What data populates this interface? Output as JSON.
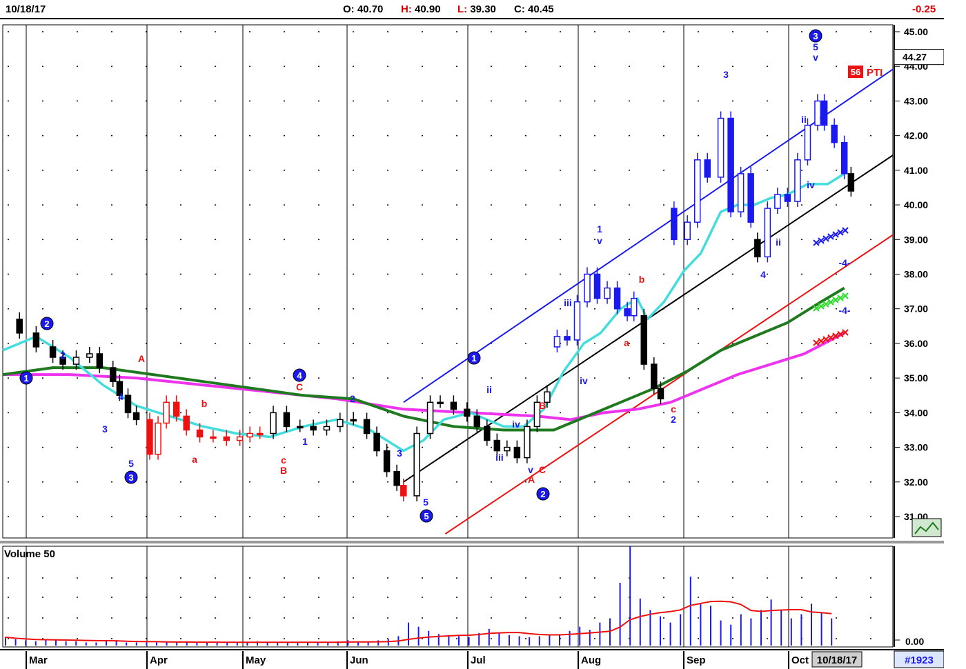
{
  "header": {
    "date": "10/18/17",
    "open_label": "O:",
    "open": "40.70",
    "high_label": "H:",
    "high": "40.90",
    "low_label": "L:",
    "low": "39.30",
    "close_label": "C:",
    "close": "40.45",
    "change": "-0.25"
  },
  "price_tag": "44.27",
  "volume_panel": {
    "title": "Volume 50",
    "axis_label": "0.00"
  },
  "footer": {
    "date_box": "10/18/17",
    "chart_id": "#1923"
  },
  "months": [
    "Mar",
    "Apr",
    "May",
    "Jun",
    "Jul",
    "Aug",
    "Sep",
    "Oct"
  ],
  "pti_badge": {
    "number": "56",
    "text": "PTI"
  },
  "colors": {
    "up_down_red": "#ee1111",
    "candle_blue": "#1a1aee",
    "candle_black": "#000000",
    "ma_cyan": "#44dddd",
    "ma_green": "#1f7a1f",
    "ma_magenta": "#ee33ee",
    "channel_blue": "#1a1aee",
    "channel_black": "#000000",
    "channel_red": "#ee1111"
  },
  "chart_data": {
    "type": "candlestick",
    "ylim": [
      31,
      45
    ],
    "yticks": [
      "31.00",
      "32.00",
      "33.00",
      "34.00",
      "35.00",
      "36.00",
      "37.00",
      "38.00",
      "39.00",
      "40.00",
      "41.00",
      "42.00",
      "43.00",
      "44.00",
      "45.00"
    ],
    "price_segments": [
      {
        "color": "black",
        "points": [
          [
            0,
            36.7
          ],
          [
            10,
            36.3
          ],
          [
            20,
            35.9
          ],
          [
            30,
            35.6
          ],
          [
            36,
            35.4
          ],
          [
            44,
            35.6
          ],
          [
            52,
            35.7
          ],
          [
            58,
            35.3
          ],
          [
            66,
            34.9
          ],
          [
            70,
            34.5
          ],
          [
            75,
            34.0
          ],
          [
            80,
            33.8
          ]
        ]
      },
      {
        "color": "red",
        "points": [
          [
            80,
            33.8
          ],
          [
            88,
            32.8
          ],
          [
            93,
            33.7
          ],
          [
            98,
            34.3
          ],
          [
            104,
            33.9
          ],
          [
            110,
            33.5
          ],
          [
            118,
            33.3
          ],
          [
            126,
            33.3
          ],
          [
            134,
            33.2
          ],
          [
            142,
            33.3
          ],
          [
            148,
            33.4
          ],
          [
            154,
            33.4
          ]
        ]
      },
      {
        "color": "black",
        "points": [
          [
            154,
            33.4
          ],
          [
            162,
            34.0
          ],
          [
            170,
            33.6
          ],
          [
            178,
            33.6
          ],
          [
            186,
            33.5
          ],
          [
            194,
            33.6
          ],
          [
            202,
            33.8
          ],
          [
            210,
            33.8
          ],
          [
            218,
            33.4
          ],
          [
            224,
            32.9
          ],
          [
            230,
            32.3
          ],
          [
            236,
            31.9
          ]
        ]
      },
      {
        "color": "red",
        "points": [
          [
            236,
            31.9
          ],
          [
            240,
            31.6
          ]
        ]
      },
      {
        "color": "black",
        "points": [
          [
            240,
            31.6
          ],
          [
            248,
            33.4
          ],
          [
            256,
            34.3
          ],
          [
            262,
            34.3
          ],
          [
            270,
            34.1
          ],
          [
            278,
            33.9
          ],
          [
            284,
            33.6
          ],
          [
            290,
            33.2
          ],
          [
            296,
            32.9
          ],
          [
            302,
            33.0
          ],
          [
            308,
            32.7
          ],
          [
            314,
            33.6
          ],
          [
            320,
            34.3
          ],
          [
            326,
            34.6
          ]
        ]
      },
      {
        "color": "blue",
        "points": [
          [
            326,
            35.9
          ],
          [
            332,
            36.2
          ],
          [
            338,
            36.1
          ],
          [
            344,
            37.2
          ],
          [
            350,
            38.0
          ],
          [
            356,
            37.3
          ],
          [
            362,
            37.6
          ],
          [
            368,
            37.0
          ],
          [
            374,
            36.8
          ],
          [
            378,
            37.3
          ]
        ]
      },
      {
        "color": "black",
        "points": [
          [
            378,
            36.8
          ],
          [
            384,
            35.4
          ],
          [
            390,
            34.7
          ],
          [
            394,
            34.4
          ]
        ]
      },
      {
        "color": "blue",
        "points": [
          [
            394,
            39.9
          ],
          [
            402,
            39.0
          ],
          [
            410,
            39.5
          ],
          [
            416,
            41.3
          ],
          [
            422,
            40.8
          ],
          [
            430,
            42.5
          ],
          [
            436,
            39.8
          ],
          [
            442,
            40.9
          ],
          [
            448,
            39.5
          ]
        ]
      },
      {
        "color": "black",
        "points": [
          [
            448,
            39.0
          ],
          [
            452,
            38.5
          ]
        ]
      },
      {
        "color": "blue",
        "points": [
          [
            452,
            38.5
          ],
          [
            458,
            39.9
          ],
          [
            464,
            40.3
          ],
          [
            470,
            40.1
          ],
          [
            476,
            41.3
          ],
          [
            482,
            42.3
          ],
          [
            488,
            43.0
          ],
          [
            492,
            42.3
          ],
          [
            498,
            41.8
          ],
          [
            504,
            40.9
          ]
        ]
      },
      {
        "color": "black",
        "points": [
          [
            504,
            40.9
          ],
          [
            508,
            40.4
          ]
        ]
      }
    ],
    "ma_cyan": [
      [
        0,
        35.8
      ],
      [
        20,
        36.2
      ],
      [
        40,
        35.6
      ],
      [
        60,
        34.8
      ],
      [
        80,
        34.2
      ],
      [
        100,
        33.9
      ],
      [
        120,
        33.6
      ],
      [
        140,
        33.4
      ],
      [
        160,
        33.3
      ],
      [
        180,
        33.6
      ],
      [
        200,
        33.8
      ],
      [
        220,
        33.5
      ],
      [
        240,
        32.9
      ],
      [
        252,
        33.2
      ],
      [
        264,
        33.8
      ],
      [
        280,
        34.0
      ],
      [
        300,
        33.6
      ],
      [
        312,
        33.6
      ],
      [
        324,
        34.1
      ],
      [
        336,
        35.2
      ],
      [
        348,
        36.0
      ],
      [
        358,
        36.3
      ],
      [
        370,
        37.0
      ],
      [
        380,
        37.3
      ],
      [
        386,
        36.7
      ],
      [
        396,
        37.2
      ],
      [
        408,
        38.1
      ],
      [
        418,
        38.6
      ],
      [
        430,
        39.8
      ],
      [
        440,
        40.0
      ],
      [
        450,
        40.0
      ],
      [
        460,
        40.2
      ],
      [
        470,
        40.3
      ],
      [
        482,
        40.6
      ],
      [
        494,
        40.6
      ],
      [
        504,
        40.9
      ]
    ],
    "ma_green": [
      [
        0,
        35.1
      ],
      [
        30,
        35.3
      ],
      [
        60,
        35.3
      ],
      [
        90,
        35.1
      ],
      [
        120,
        34.9
      ],
      [
        150,
        34.7
      ],
      [
        180,
        34.5
      ],
      [
        210,
        34.4
      ],
      [
        240,
        33.9
      ],
      [
        270,
        33.6
      ],
      [
        300,
        33.5
      ],
      [
        330,
        33.5
      ],
      [
        350,
        33.9
      ],
      [
        370,
        34.3
      ],
      [
        390,
        34.7
      ],
      [
        410,
        35.2
      ],
      [
        430,
        35.8
      ],
      [
        450,
        36.2
      ],
      [
        470,
        36.6
      ],
      [
        490,
        37.2
      ],
      [
        504,
        37.6
      ]
    ],
    "ma_magenta": [
      [
        0,
        35.1
      ],
      [
        40,
        35.1
      ],
      [
        80,
        35.0
      ],
      [
        120,
        34.8
      ],
      [
        160,
        34.6
      ],
      [
        200,
        34.4
      ],
      [
        240,
        34.1
      ],
      [
        280,
        34.0
      ],
      [
        320,
        33.9
      ],
      [
        340,
        33.8
      ],
      [
        360,
        34.0
      ],
      [
        380,
        34.1
      ],
      [
        400,
        34.3
      ],
      [
        420,
        34.7
      ],
      [
        440,
        35.1
      ],
      [
        460,
        35.4
      ],
      [
        480,
        35.7
      ],
      [
        504,
        36.3
      ]
    ],
    "channels": [
      {
        "color": "blue",
        "from": [
          240,
          34.3
        ],
        "to": [
          560,
          44.8
        ]
      },
      {
        "color": "black",
        "from": [
          240,
          32.0
        ],
        "to": [
          560,
          42.3
        ]
      },
      {
        "color": "red",
        "from": [
          265,
          30.5
        ],
        "to": [
          560,
          40.0
        ]
      }
    ],
    "volume": [
      8,
      6,
      5,
      4,
      5,
      5,
      4,
      4,
      3,
      3,
      4,
      4,
      3,
      3,
      3,
      3,
      3,
      3,
      4,
      3,
      3,
      3,
      3,
      3,
      3,
      4,
      3,
      3,
      3,
      3,
      3,
      3,
      3,
      4,
      5,
      4,
      4,
      5,
      6,
      9,
      22,
      18,
      14,
      11,
      9,
      9,
      8,
      12,
      16,
      12,
      10,
      9,
      8,
      9,
      10,
      11,
      14,
      18,
      15,
      22,
      26,
      60,
      95,
      45,
      34,
      28,
      22,
      30,
      66,
      40,
      38,
      24,
      20,
      30,
      26,
      34,
      44,
      34,
      26,
      30,
      40,
      32,
      26
    ]
  },
  "annotations": [
    {
      "t": "1",
      "x": 38,
      "y": 548,
      "c": "blue",
      "circle": true
    },
    {
      "t": "2",
      "x": 68,
      "y": 469,
      "c": "blue",
      "circle": true
    },
    {
      "t": "2",
      "x": 91,
      "y": 520,
      "c": "blue"
    },
    {
      "t": "3",
      "x": 152,
      "y": 627,
      "c": "blue"
    },
    {
      "t": "4",
      "x": 175,
      "y": 580,
      "c": "blue"
    },
    {
      "t": "5",
      "x": 190,
      "y": 677,
      "c": "blue"
    },
    {
      "t": "3",
      "x": 190,
      "y": 692,
      "c": "blue",
      "circle": true
    },
    {
      "t": "A",
      "x": 205,
      "y": 525,
      "c": "red"
    },
    {
      "t": "b",
      "x": 296,
      "y": 590,
      "c": "red"
    },
    {
      "t": "a",
      "x": 282,
      "y": 671,
      "c": "red"
    },
    {
      "t": "C",
      "x": 434,
      "y": 566,
      "c": "red"
    },
    {
      "t": "4",
      "x": 434,
      "y": 544,
      "c": "blue",
      "circle": true
    },
    {
      "t": "c",
      "x": 411,
      "y": 672,
      "c": "red"
    },
    {
      "t": "B",
      "x": 411,
      "y": 687,
      "c": "red"
    },
    {
      "t": "1",
      "x": 442,
      "y": 645,
      "c": "blue"
    },
    {
      "t": "2",
      "x": 511,
      "y": 583,
      "c": "blue"
    },
    {
      "t": "3",
      "x": 579,
      "y": 662,
      "c": "blue"
    },
    {
      "t": "5",
      "x": 617,
      "y": 733,
      "c": "blue"
    },
    {
      "t": "5",
      "x": 618,
      "y": 748,
      "c": "blue",
      "circle": true
    },
    {
      "t": "1",
      "x": 687,
      "y": 519,
      "c": "blue",
      "circle": true
    },
    {
      "t": "ii",
      "x": 709,
      "y": 570,
      "c": "blue"
    },
    {
      "t": "iv",
      "x": 748,
      "y": 620,
      "c": "blue"
    },
    {
      "t": "iii",
      "x": 724,
      "y": 668,
      "c": "blue"
    },
    {
      "t": "v",
      "x": 769,
      "y": 686,
      "c": "blue"
    },
    {
      "t": "A",
      "x": 770,
      "y": 700,
      "c": "red"
    },
    {
      "t": "C",
      "x": 786,
      "y": 686,
      "c": "red"
    },
    {
      "t": "B",
      "x": 786,
      "y": 593,
      "c": "red"
    },
    {
      "t": "2",
      "x": 787,
      "y": 716,
      "c": "blue",
      "circle": true
    },
    {
      "t": "iii",
      "x": 823,
      "y": 444,
      "c": "blue"
    },
    {
      "t": "iv",
      "x": 846,
      "y": 557,
      "c": "blue"
    },
    {
      "t": "1",
      "x": 869,
      "y": 337,
      "c": "blue"
    },
    {
      "t": "v",
      "x": 869,
      "y": 354,
      "c": "blue"
    },
    {
      "t": "b",
      "x": 930,
      "y": 410,
      "c": "red"
    },
    {
      "t": "a",
      "x": 908,
      "y": 502,
      "c": "red"
    },
    {
      "t": "c",
      "x": 976,
      "y": 598,
      "c": "red"
    },
    {
      "t": "2",
      "x": 976,
      "y": 613,
      "c": "blue"
    },
    {
      "t": "3",
      "x": 1052,
      "y": 113,
      "c": "blue"
    },
    {
      "t": "ii",
      "x": 1128,
      "y": 356,
      "c": "blue"
    },
    {
      "t": "4",
      "x": 1106,
      "y": 403,
      "c": "blue"
    },
    {
      "t": "ii",
      "x": 1165,
      "y": 178,
      "c": "blue"
    },
    {
      "t": "iv",
      "x": 1175,
      "y": 273,
      "c": "blue"
    },
    {
      "t": "3",
      "x": 1182,
      "y": 52,
      "c": "blue",
      "circle": true
    },
    {
      "t": "5",
      "x": 1182,
      "y": 73,
      "c": "blue"
    },
    {
      "t": "v",
      "x": 1182,
      "y": 88,
      "c": "blue"
    },
    {
      "t": "-4-",
      "x": 1224,
      "y": 386,
      "c": "blue"
    },
    {
      "t": "-4-",
      "x": 1224,
      "y": 455,
      "c": "blue"
    }
  ]
}
